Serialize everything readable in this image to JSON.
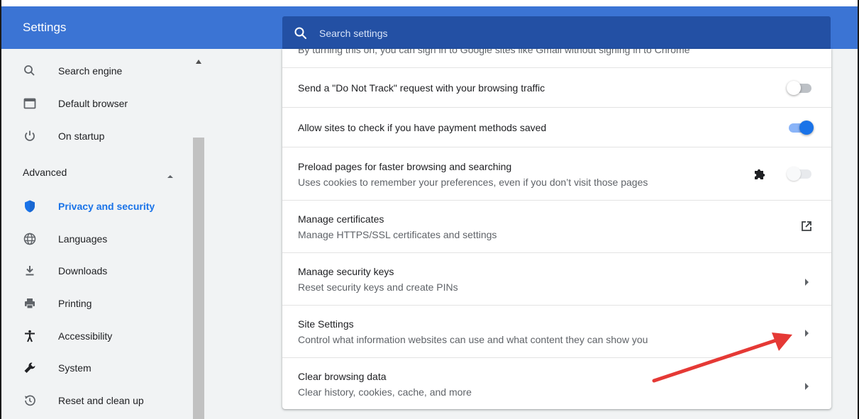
{
  "header": {
    "title": "Settings",
    "search_placeholder": "Search settings"
  },
  "sidebar": {
    "items": [
      {
        "label": "Search engine",
        "icon": "search-icon"
      },
      {
        "label": "Default browser",
        "icon": "browser-window-icon"
      },
      {
        "label": "On startup",
        "icon": "power-icon"
      }
    ],
    "advanced_label": "Advanced",
    "advanced_items": [
      {
        "label": "Privacy and security",
        "icon": "shield-icon",
        "active": true
      },
      {
        "label": "Languages",
        "icon": "globe-icon"
      },
      {
        "label": "Downloads",
        "icon": "download-icon"
      },
      {
        "label": "Printing",
        "icon": "printer-icon"
      },
      {
        "label": "Accessibility",
        "icon": "accessibility-icon"
      },
      {
        "label": "System",
        "icon": "wrench-icon"
      },
      {
        "label": "Reset and clean up",
        "icon": "restore-icon"
      }
    ]
  },
  "main": {
    "clipped_text": "By turning this on, you can sign in to Google sites like Gmail without signing in to Chrome",
    "rows": [
      {
        "primary": "Send a \"Do Not Track\" request with your browsing traffic",
        "control": "toggle",
        "state": "off"
      },
      {
        "primary": "Allow sites to check if you have payment methods saved",
        "control": "toggle",
        "state": "on"
      },
      {
        "primary": "Preload pages for faster browsing and searching",
        "secondary": "Uses cookies to remember your preferences, even if you don’t visit those pages",
        "control": "toggle",
        "state": "disabled",
        "extra_icon": "puzzle-icon"
      },
      {
        "primary": "Manage certificates",
        "secondary": "Manage HTTPS/SSL certificates and settings",
        "control": "external-link-icon"
      },
      {
        "primary": "Manage security keys",
        "secondary": "Reset security keys and create PINs",
        "control": "arrow-right-icon"
      },
      {
        "primary": "Site Settings",
        "secondary": "Control what information websites can use and what content they can show you",
        "control": "arrow-right-icon"
      },
      {
        "primary": "Clear browsing data",
        "secondary": "Clear history, cookies, cache, and more",
        "control": "arrow-right-icon"
      }
    ]
  },
  "colors": {
    "header": "#3b74d4",
    "search_bg": "#2350a4",
    "accent": "#1a73e8",
    "annotation_arrow": "#e53935"
  }
}
